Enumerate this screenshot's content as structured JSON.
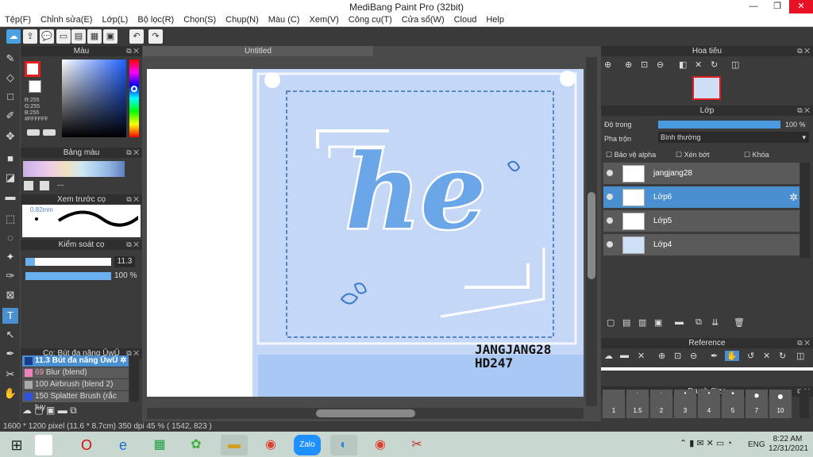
{
  "app": {
    "title": "MediBang Paint Pro (32bit)",
    "doc_tab": "Untitled"
  },
  "menu": [
    "Tệp(F)",
    "Chỉnh sửa(E)",
    "Lớp(L)",
    "Bộ lọc(R)",
    "Chọn(S)",
    "Chụp(N)",
    "Màu (C)",
    "Xem(V)",
    "Công cụ(T)",
    "Cửa sổ(W)",
    "Cloud",
    "Help"
  ],
  "color_panel": {
    "title": "Màu",
    "r": "R:255",
    "g": "G:255",
    "b": "B:255",
    "hex": "#FFFFFF",
    "accent": "#e02020"
  },
  "palette_panel": {
    "title": "Bảng màu",
    "dash": "---"
  },
  "brush_preview": {
    "title": "Xem trước cọ",
    "size": "0.82mm"
  },
  "brush_control": {
    "title": "Kiểm soát cọ",
    "size_value": "11.3",
    "opacity_value": "100 %",
    "size_fraction": 0.11,
    "opacity_fraction": 1.0
  },
  "brush_list": {
    "title": "Cọ: Bút đa năng ŪwŪ",
    "items": [
      {
        "size": "11.3",
        "name": "Bút đa năng ŪwŪ",
        "color": "#1a3a8a",
        "selected": true
      },
      {
        "size": "69",
        "name": "Blur (blend)",
        "color": "#f080c0",
        "selected": false
      },
      {
        "size": "100",
        "name": "Airbrush (blend 2)",
        "color": "#aaaaaa",
        "selected": false
      },
      {
        "size": "150",
        "name": "Splatter Brush (rắc tuy",
        "color": "#3050e0",
        "selected": false
      }
    ]
  },
  "navigator": {
    "title": "Hoa tiêu"
  },
  "layers": {
    "title": "Lớp",
    "opacity_label": "Độ trong",
    "opacity_value": "100 %",
    "opacity_fraction": 1.0,
    "blend_label": "Pha trộn",
    "blend_value": "Bình thường",
    "protect_alpha": "Bảo vệ alpha",
    "clipping": "Xén bớt",
    "lock": "Khóa",
    "items": [
      {
        "name": "jangjang28",
        "selected": false
      },
      {
        "name": "Lớp6",
        "selected": true
      },
      {
        "name": "Lớp5",
        "selected": false
      },
      {
        "name": "Lớp4",
        "selected": false
      }
    ]
  },
  "reference": {
    "title": "Reference"
  },
  "brush_size": {
    "title": "Brush Size",
    "sizes": [
      "1",
      "1.5",
      "2",
      "3",
      "4",
      "5",
      "7",
      "10"
    ]
  },
  "canvas": {
    "word": "he",
    "signature_line1": "JANGJANG28",
    "signature_line2": "HD247"
  },
  "status": {
    "text": "1600 * 1200 pixel   (11.6 * 8.7cm)   350 dpi   45 %   ( 1542, 823 )"
  },
  "taskbar": {
    "lang": "ENG",
    "time": "8:22 AM",
    "date": "12/31/2021",
    "zalo": "Zalo"
  }
}
